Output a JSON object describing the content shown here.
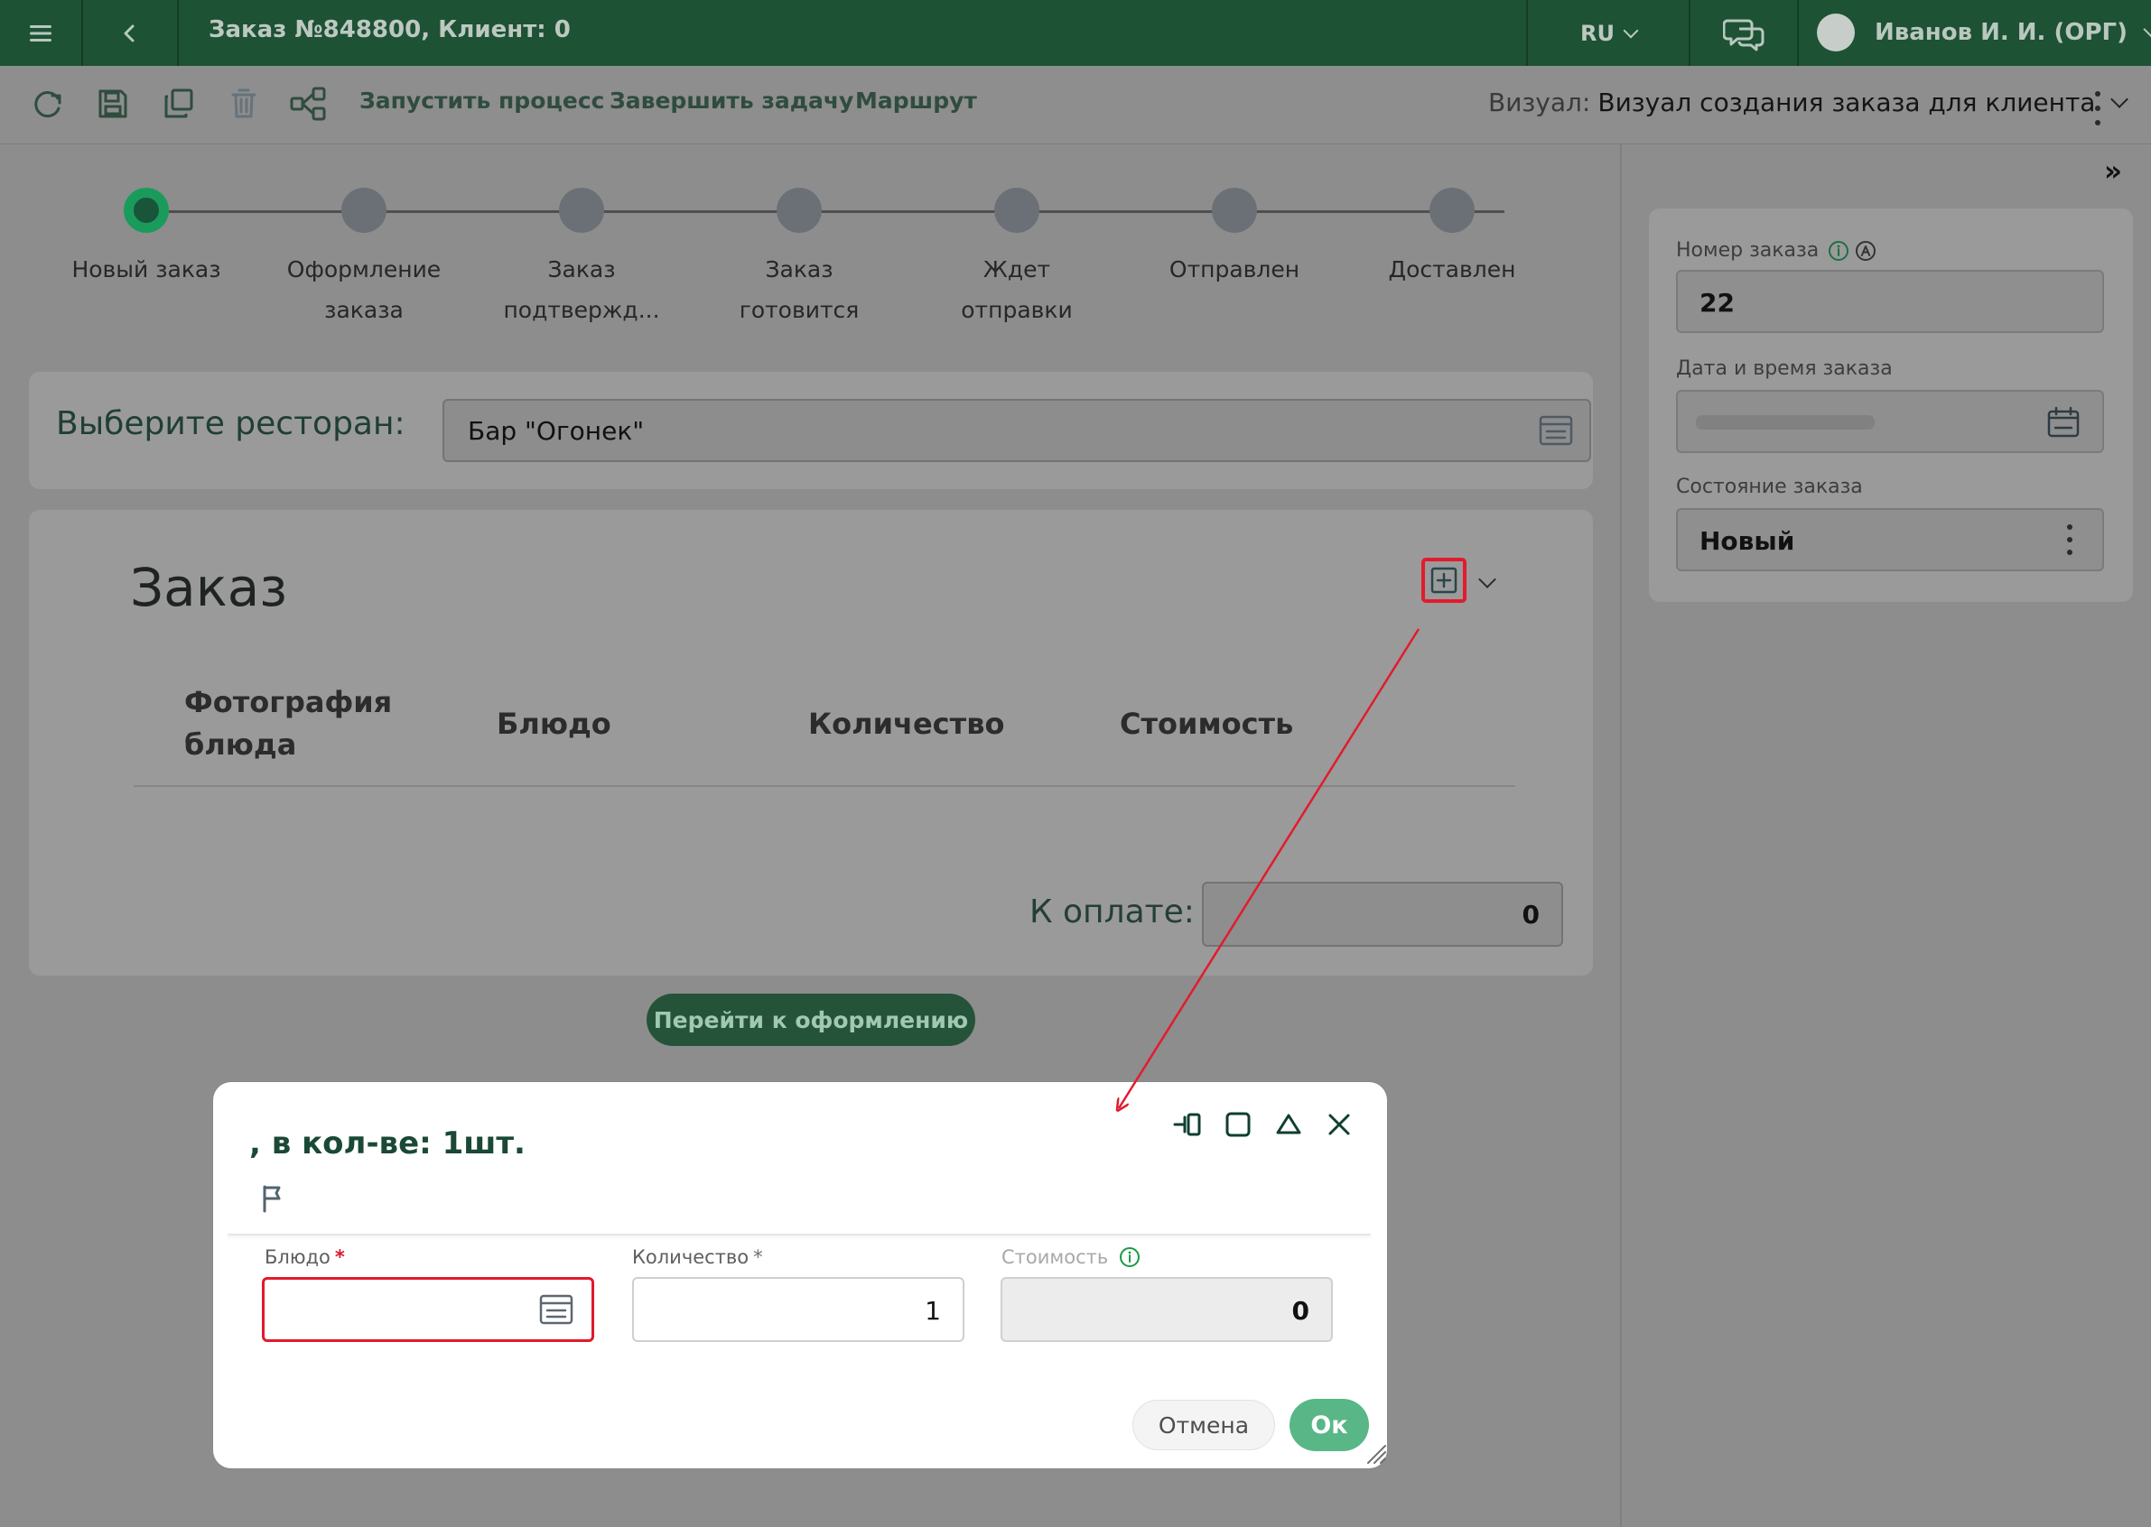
{
  "header": {
    "title": "Заказ №848800, Клиент: 0",
    "language": "RU",
    "user": "Иванов И. И. (ОРГ)"
  },
  "toolbar": {
    "actions": [
      "Запустить процесс",
      "Завершить задачу",
      "Маршрут"
    ],
    "visual_label": "Визуал:",
    "visual_value": "Визуал создания заказа для клиента"
  },
  "stepper": {
    "steps": [
      "Новый заказ",
      "Оформление заказа",
      "Заказ подтвержд...",
      "Заказ готовится",
      "Ждет отправки",
      "Отправлен",
      "Доставлен"
    ],
    "active_index": 0
  },
  "restaurant": {
    "label": "Выберите ресторан:",
    "value": "Бар \"Огонек\""
  },
  "order": {
    "title": "Заказ",
    "columns": [
      "Фотография блюда",
      "Блюдо",
      "Количество",
      "Стоимость"
    ],
    "pay_label": "К оплате:",
    "pay_value": "0",
    "next_button": "Перейти к оформлению"
  },
  "sidebar": {
    "fields": [
      {
        "label": "Номер заказа",
        "value": "22",
        "icons": [
          "info-icon",
          "auto-icon"
        ]
      },
      {
        "label": "Дата и время заказа",
        "value": "",
        "icons": [
          "calendar-icon"
        ]
      },
      {
        "label": "Состояние заказа",
        "value": "Новый",
        "icons": [
          "more-vertical-icon"
        ]
      }
    ]
  },
  "modal": {
    "title": ", в кол-ве: 1шт.",
    "fields": [
      {
        "label": "Блюдо",
        "value": "",
        "required": true
      },
      {
        "label": "Количество",
        "value": "1",
        "required": true
      },
      {
        "label": "Стоимость",
        "value": "0",
        "required": false
      }
    ],
    "cancel_label": "Отмена",
    "ok_label": "Ок"
  },
  "colors": {
    "header_green": "#1d5234",
    "accent_green": "#1b9b5b",
    "highlight_red": "#e21b2d",
    "ok_green": "#59b787"
  }
}
